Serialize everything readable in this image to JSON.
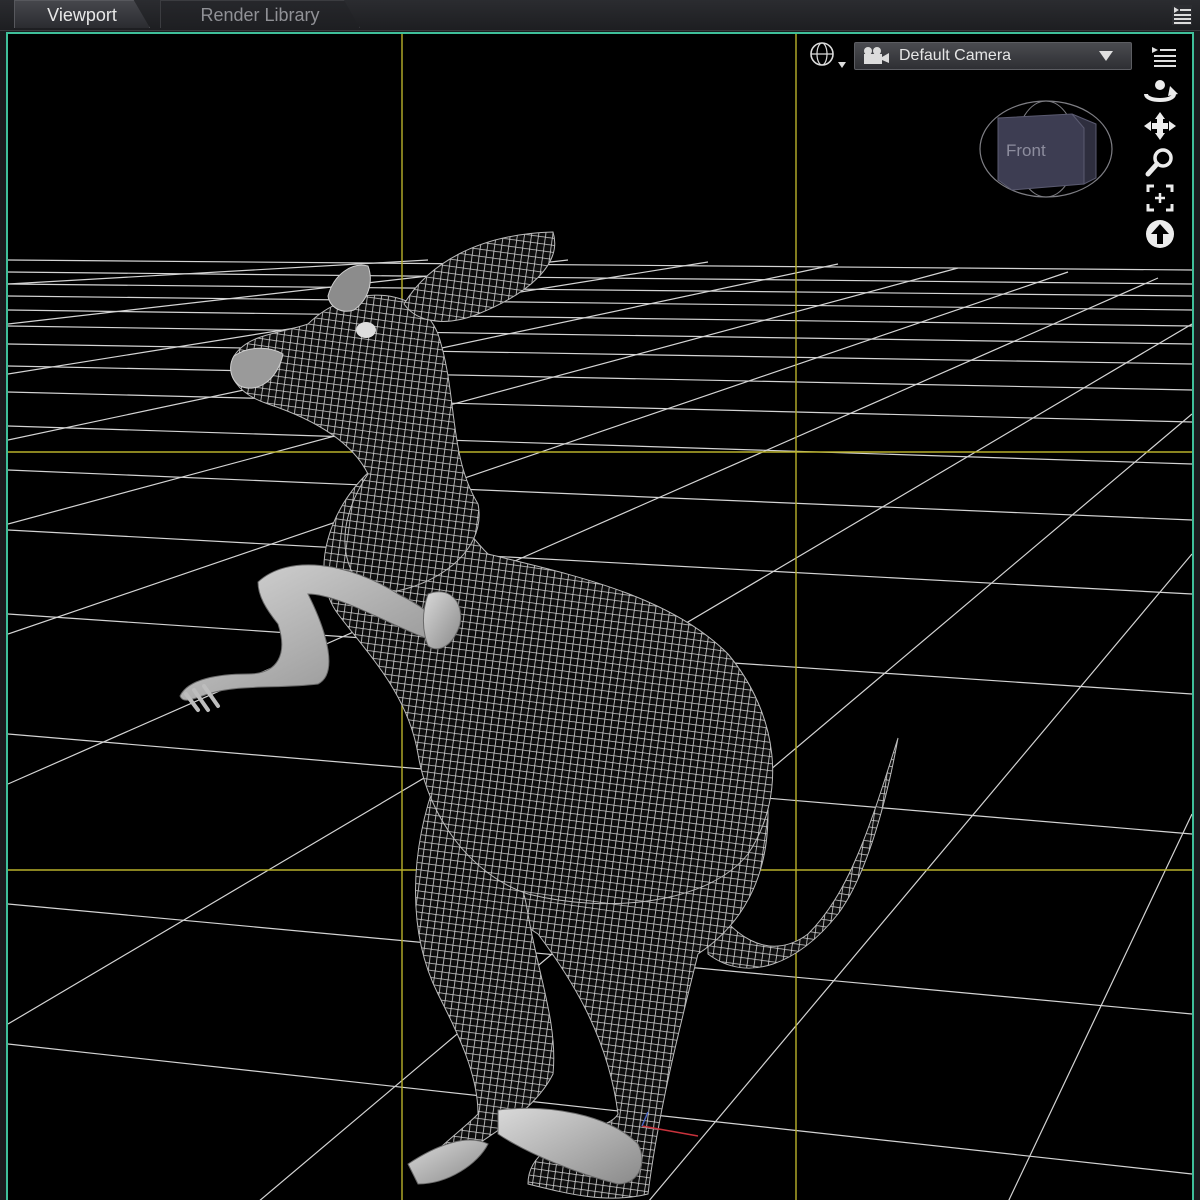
{
  "tabs": [
    {
      "label": "Viewport",
      "active": true
    },
    {
      "label": "Render Library",
      "active": false
    }
  ],
  "viewport": {
    "camera": "Default Camera",
    "nav_cube_face": "Front",
    "colors": {
      "frame_accent": "#3fbf9a",
      "guide_lines": "#b8b02a",
      "floor_grid": "#e6e6e6",
      "background": "#000000"
    },
    "tools": [
      "orbit-icon",
      "pan-icon",
      "zoom-icon",
      "frame-icon",
      "reset-view-icon"
    ]
  }
}
